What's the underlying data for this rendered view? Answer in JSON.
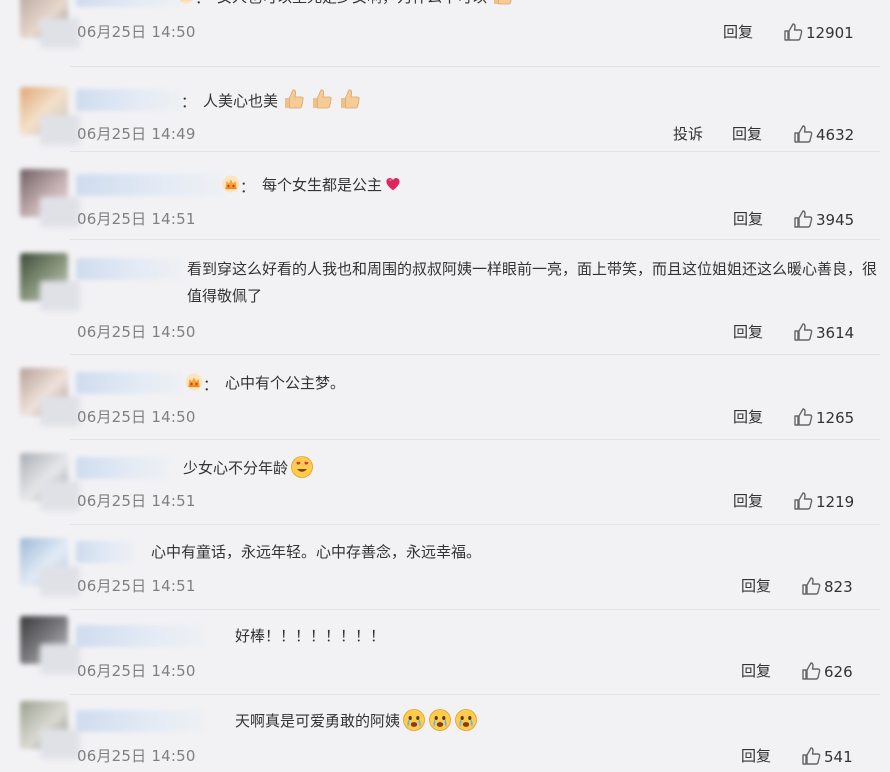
{
  "actions": {
    "reply": "回复",
    "report": "投诉"
  },
  "comments": [
    {
      "text": "女人也可以至死是少女啊，为什么不可以",
      "emoji": [
        "thumbs-up-icon"
      ],
      "time": "06月25日 14:50",
      "likes": "12901",
      "verified": true
    },
    {
      "text": "人美心也美",
      "emoji": [
        "thumbs-up-icon",
        "thumbs-up-icon",
        "thumbs-up-icon"
      ],
      "time": "06月25日 14:49",
      "likes": "4632",
      "report": true
    },
    {
      "text": "每个女生都是公主",
      "emoji": [
        "heart-icon"
      ],
      "time": "06月25日 14:51",
      "likes": "3945",
      "verified": true
    },
    {
      "text": "看到穿这么好看的人我也和周围的叔叔阿姨一样眼前一亮，面上带笑，而且这位姐姐还这么暖心善良，很值得敬佩了",
      "emoji": [],
      "time": "06月25日 14:50",
      "likes": "3614"
    },
    {
      "text": "心中有个公主梦。",
      "emoji": [],
      "time": "06月25日 14:50",
      "likes": "1265",
      "verified": true
    },
    {
      "text": "少女心不分年龄",
      "emoji": [
        "heart-eyes-icon"
      ],
      "time": "06月25日 14:51",
      "likes": "1219"
    },
    {
      "text": "心中有童话，永远年轻。心中存善念，永远幸福。",
      "emoji": [],
      "time": "06月25日 14:51",
      "likes": "823"
    },
    {
      "text": "好棒！！！！！！！！",
      "emoji": [],
      "time": "06月25日 14:50",
      "likes": "626"
    },
    {
      "text": "天啊真是可爱勇敢的阿姨",
      "emoji": [
        "crying-face-icon",
        "crying-face-icon",
        "crying-face-icon"
      ],
      "time": "06月25日 14:50",
      "likes": "541"
    }
  ],
  "colors": {
    "background": "#f2f2f5",
    "time": "#808080",
    "crown": "#f5a623",
    "heart": "#e0245e"
  }
}
